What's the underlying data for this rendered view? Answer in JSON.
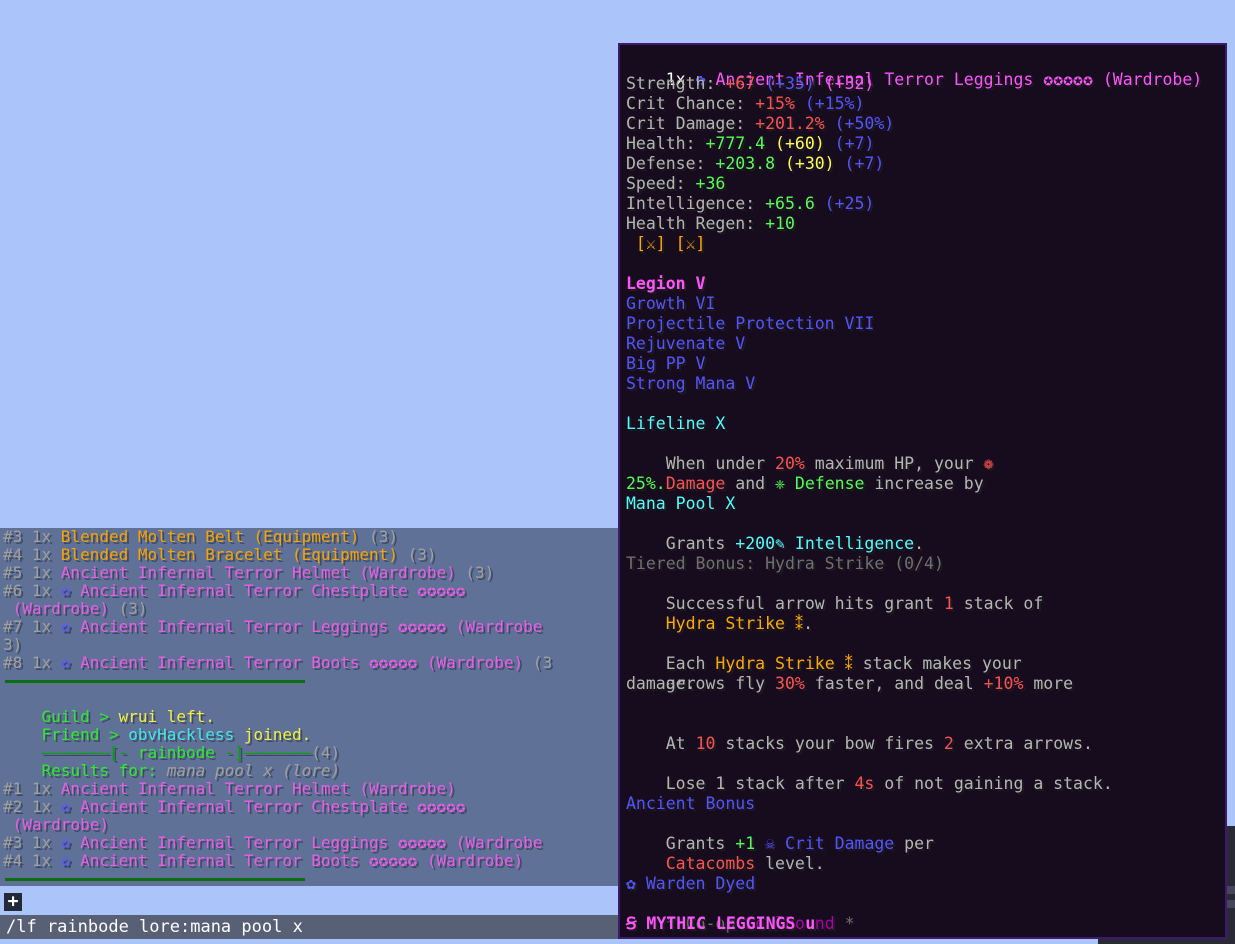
{
  "chat": {
    "lines_top": [
      {
        "idx": "#3 1x ",
        "name": "Blended Molten Belt (Equipment)",
        "name_color": "gold",
        "count": " (3)"
      },
      {
        "idx": "#4 1x ",
        "name": "Blended Molten Bracelet (Equipment)",
        "name_color": "gold",
        "count": " (3)"
      },
      {
        "idx": "#5 1x ",
        "name": "Ancient Infernal Terror Helmet (Wardrobe)",
        "name_color": "pink",
        "count": " (3)"
      },
      {
        "idx": "#6 1x ",
        "icon": "✿ ",
        "name": "Ancient Infernal Terror Chestplate ✪✪✪✪✪",
        "name_color": "pink",
        "count": ""
      },
      {
        "idx": "",
        "name": " (Wardrobe)",
        "name_color": "pink",
        "count": " (3)"
      },
      {
        "idx": "#7 1x ",
        "icon": "✿ ",
        "name": "Ancient Infernal Terror Leggings ✪✪✪✪✪ (Wardrobe",
        "name_color": "pink",
        "count": ""
      },
      {
        "idx": "3)",
        "name": "",
        "name_color": "pink",
        "count": ""
      },
      {
        "idx": "#8 1x ",
        "icon": "✿ ",
        "name": "Ancient Infernal Terror Boots ✪✪✪✪✪ (Wardrobe)",
        "name_color": "pink",
        "count": " (3"
      }
    ],
    "guild_prefix": "Guild > ",
    "guild_user": "wrui",
    "guild_action": " left.",
    "friend_prefix": "Friend > ",
    "friend_user": "obvHackless",
    "friend_action": " joined.",
    "rainbode_left": "———————[- ",
    "rainbode_name": "rainbode",
    "rainbode_right": " -]———————",
    "rainbode_count": "(4)",
    "results_label": "Results for: ",
    "results_query": "mana pool x (lore)",
    "lines_bottom": [
      {
        "idx": "#1 1x ",
        "name": "Ancient Infernal Terror Helmet (Wardrobe)",
        "name_color": "pink"
      },
      {
        "idx": "#2 1x ",
        "icon": "✿ ",
        "name": "Ancient Infernal Terror Chestplate ✪✪✪✪✪",
        "name_color": "pink"
      },
      {
        "idx": "",
        "name": " (Wardrobe)",
        "name_color": "pink"
      },
      {
        "idx": "#3 1x ",
        "icon": "✿ ",
        "name": "Ancient Infernal Terror Leggings ✪✪✪✪✪ (Wardrobe",
        "name_color": "pink"
      },
      {
        "idx": "#4 1x ",
        "icon": "✿ ",
        "name": "Ancient Infernal Terror Boots ✪✪✪✪✪ (Wardrobe)",
        "name_color": "pink"
      }
    ],
    "input_plus": "+",
    "input_text": "/lf rainbode lore:mana pool x"
  },
  "tooltip": {
    "title_count": "1x ",
    "title_icon": "✿ ",
    "title_name": "Ancient Infernal Terror Leggings ✪✪✪✪✪ (Wardrobe)",
    "stats": [
      {
        "label": "Strength: ",
        "value": "+67",
        "value_color": "red",
        "extras": [
          {
            "text": " (+35)",
            "color": "blue"
          },
          {
            "text": " (+32)",
            "color": "pink"
          }
        ]
      },
      {
        "label": "Crit Chance: ",
        "value": "+15%",
        "value_color": "red",
        "extras": [
          {
            "text": " (+15%)",
            "color": "blue"
          }
        ]
      },
      {
        "label": "Crit Damage: ",
        "value": "+201.2%",
        "value_color": "red",
        "extras": [
          {
            "text": " (+50%)",
            "color": "blue"
          }
        ]
      },
      {
        "label": "Health: ",
        "value": "+777.4",
        "value_color": "lime",
        "extras": [
          {
            "text": " (+60)",
            "color": "yellow"
          },
          {
            "text": " (+7)",
            "color": "blue"
          }
        ]
      },
      {
        "label": "Defense: ",
        "value": "+203.8",
        "value_color": "lime",
        "extras": [
          {
            "text": " (+30)",
            "color": "yellow"
          },
          {
            "text": " (+7)",
            "color": "blue"
          }
        ]
      },
      {
        "label": "Speed: ",
        "value": "+36",
        "value_color": "lime",
        "extras": []
      },
      {
        "label": "Intelligence: ",
        "value": "+65.6",
        "value_color": "lime",
        "extras": [
          {
            "text": " (+25)",
            "color": "blue"
          }
        ]
      },
      {
        "label": "Health Regen: ",
        "value": "+10",
        "value_color": "lime",
        "extras": []
      }
    ],
    "slots": " [⚔] [⚔]",
    "enchants": [
      {
        "text": "Legion V",
        "color": "pink",
        "bold": true
      },
      {
        "text": "Growth VI",
        "color": "blue"
      },
      {
        "text": "Projectile Protection VII",
        "color": "blue"
      },
      {
        "text": "Rejuvenate V",
        "color": "blue"
      },
      {
        "text": "Big PP V",
        "color": "blue"
      },
      {
        "text": "Strong Mana V",
        "color": "blue"
      }
    ],
    "lifeline_title": "Lifeline X",
    "lifeline_l1_a": "When under ",
    "lifeline_l1_b": "20%",
    "lifeline_l1_c": " maximum HP, your ",
    "lifeline_l1_d": "❁",
    "lifeline_l2_a": "Damage",
    "lifeline_l2_b": " and ",
    "lifeline_l2_c": "❈ Defense",
    "lifeline_l2_d": " increase by",
    "lifeline_l3": "25%.",
    "manapool_title": "Mana Pool X",
    "manapool_a": "Grants ",
    "manapool_b": "+200✎ Intelligence",
    "manapool_c": ".",
    "tiered_title": "Tiered Bonus: Hydra Strike (0/4)",
    "tiered_l1_a": "Successful arrow hits grant ",
    "tiered_l1_b": "1",
    "tiered_l1_c": " stack of",
    "tiered_l2_a": "Hydra Strike ⁑",
    "tiered_l2_b": ".",
    "each_a": "Each ",
    "each_b": "Hydra Strike ⁑",
    "each_c": " stack makes your",
    "arrows_a": "arrows fly ",
    "arrows_b": "30%",
    "arrows_c": " faster, and deal ",
    "arrows_d": "+10%",
    "arrows_e": " more",
    "damage_line": "damage.",
    "at_a": "At ",
    "at_b": "10",
    "at_c": " stacks your bow fires ",
    "at_d": "2",
    "at_e": " extra arrows.",
    "lose_a": "Lose 1 stack after ",
    "lose_b": "4s",
    "lose_c": " of not gaining a stack.",
    "ancient_title": "Ancient Bonus",
    "ancient_l1_a": "Grants ",
    "ancient_l1_b": "+1",
    "ancient_l1_c": " ☠ Crit Damage",
    "ancient_l1_d": " per",
    "ancient_l2_a": "Catacombs",
    "ancient_l2_b": " level.",
    "dyed": "✿ Warden Dyed",
    "coop_a": "* Co-op ",
    "coop_b": "Soulbound",
    "coop_c": " *",
    "rarity": "Ꞩ MYTHIC LEGGINGS u"
  },
  "colors": {
    "background": "#abc5fb",
    "tooltip_bg": "#170b1e",
    "tooltip_border": "#3c1a6e"
  }
}
